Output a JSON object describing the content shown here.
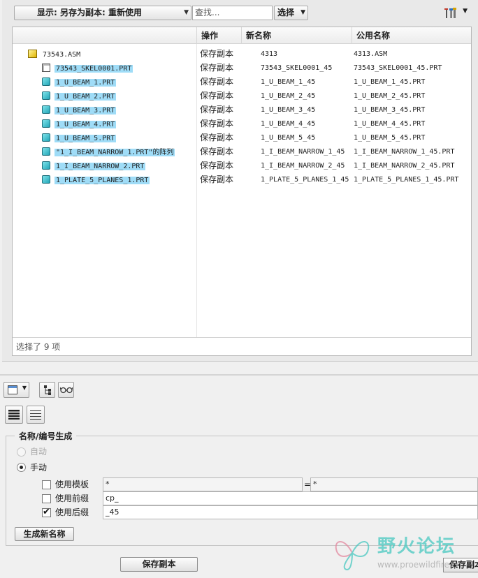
{
  "toolbar": {
    "display_combo": "显示: 另存为副本: 重新使用",
    "search_placeholder": "查找...",
    "select_label": "选择"
  },
  "table": {
    "columns": [
      "操作",
      "新名称",
      "公用名称"
    ],
    "rows": [
      {
        "name": "73543.ASM",
        "icon": "assembly-icon",
        "indent": 0,
        "selected": false,
        "action": "保存副本",
        "new_name": "4313",
        "common_name": "4313.ASM"
      },
      {
        "name": "73543_SKEL0001.PRT",
        "icon": "skeleton-part-icon",
        "indent": 1,
        "selected": true,
        "action": "保存副本",
        "new_name": "73543_SKEL0001_45",
        "common_name": "73543_SKEL0001_45.PRT"
      },
      {
        "name": "1_U_BEAM_1.PRT",
        "icon": "part-icon",
        "indent": 1,
        "selected": true,
        "action": "保存副本",
        "new_name": "1_U_BEAM_1_45",
        "common_name": "1_U_BEAM_1_45.PRT"
      },
      {
        "name": "1_U_BEAM_2.PRT",
        "icon": "part-icon",
        "indent": 1,
        "selected": true,
        "action": "保存副本",
        "new_name": "1_U_BEAM_2_45",
        "common_name": "1_U_BEAM_2_45.PRT"
      },
      {
        "name": "1_U_BEAM_3.PRT",
        "icon": "part-icon",
        "indent": 1,
        "selected": true,
        "action": "保存副本",
        "new_name": "1_U_BEAM_3_45",
        "common_name": "1_U_BEAM_3_45.PRT"
      },
      {
        "name": "1_U_BEAM_4.PRT",
        "icon": "part-icon",
        "indent": 1,
        "selected": true,
        "action": "保存副本",
        "new_name": "1_U_BEAM_4_45",
        "common_name": "1_U_BEAM_4_45.PRT"
      },
      {
        "name": "1_U_BEAM_5.PRT",
        "icon": "part-icon",
        "indent": 1,
        "selected": true,
        "action": "保存副本",
        "new_name": "1_U_BEAM_5_45",
        "common_name": "1_U_BEAM_5_45.PRT"
      },
      {
        "name": "\"1_I_BEAM_NARROW_1.PRT\"的阵列",
        "icon": "part-icon",
        "indent": 1,
        "selected": true,
        "action": "保存副本",
        "new_name": "1_I_BEAM_NARROW_1_45",
        "common_name": "1_I_BEAM_NARROW_1_45.PRT"
      },
      {
        "name": "1_I_BEAM_NARROW_2.PRT",
        "icon": "part-icon",
        "indent": 1,
        "selected": true,
        "action": "保存副本",
        "new_name": "1_I_BEAM_NARROW_2_45",
        "common_name": "1_I_BEAM_NARROW_2_45.PRT"
      },
      {
        "name": "1_PLATE_5_PLANES_1.PRT",
        "icon": "part-icon",
        "indent": 1,
        "selected": true,
        "action": "保存副本",
        "new_name": "1_PLATE_5_PLANES_1_45",
        "common_name": "1_PLATE_5_PLANES_1_45.PRT"
      }
    ],
    "status": "选择了 9 项"
  },
  "naming": {
    "title": "名称/编号生成",
    "auto_label": "自动",
    "manual_label": "手动",
    "use_template_label": "使用模板",
    "template_value": "*",
    "equals": "=",
    "template_result": "*",
    "use_prefix_label": "使用前缀",
    "prefix_value": "cp_",
    "use_suffix_label": "使用后缀",
    "suffix_value": "_45",
    "use_template_checked": false,
    "use_prefix_checked": false,
    "use_suffix_checked": true,
    "generate_button": "生成新名称"
  },
  "footer": {
    "save_copy_button": "保存副本",
    "save_copy_button_2": "保存副本"
  },
  "watermark": {
    "title": "野火论坛",
    "url": "www.proewildfire.cn"
  },
  "colors": {
    "selection": "#9fdcf7",
    "part_icon": "#23a6b8",
    "assembly_icon": "#e0b400",
    "watermark": "#49c8c0"
  }
}
